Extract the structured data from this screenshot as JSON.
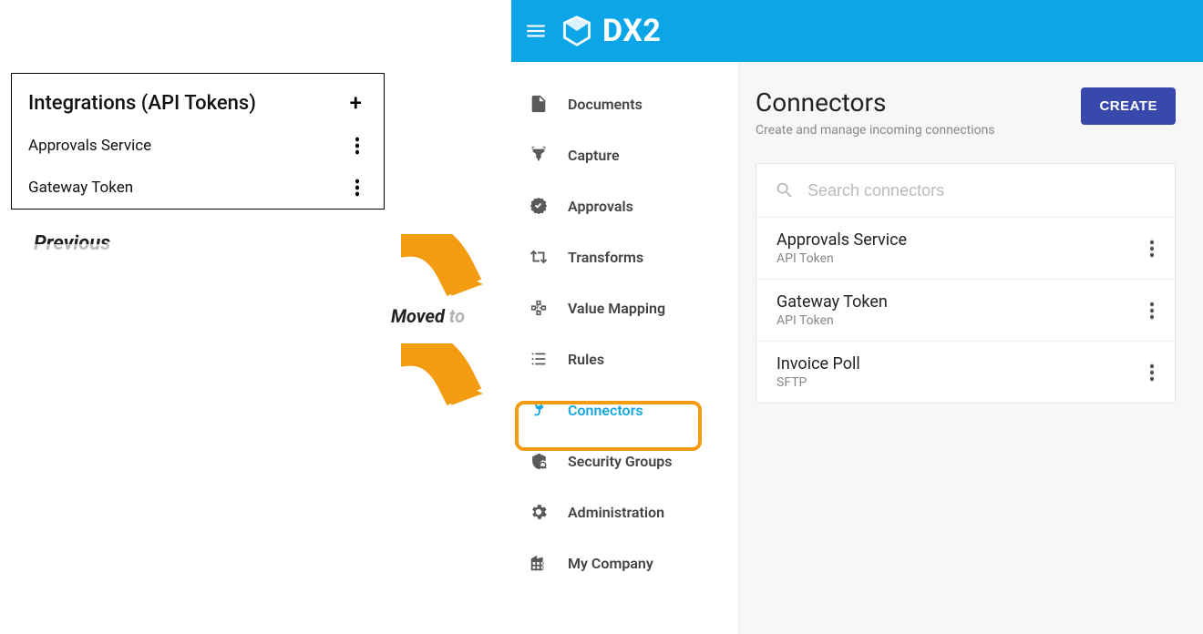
{
  "previous": {
    "title": "Integrations (API Tokens)",
    "rows": [
      "Approvals Service",
      "Gateway Token"
    ],
    "caption": "Previous"
  },
  "annotation": {
    "moved": "Moved",
    "to": " to"
  },
  "app": {
    "brand": "DX2",
    "nav": [
      {
        "icon": "doc",
        "label": "Documents"
      },
      {
        "icon": "capture",
        "label": "Capture"
      },
      {
        "icon": "approvals",
        "label": "Approvals"
      },
      {
        "icon": "transforms",
        "label": "Transforms"
      },
      {
        "icon": "mapping",
        "label": "Value Mapping"
      },
      {
        "icon": "rules",
        "label": "Rules"
      },
      {
        "icon": "connectors",
        "label": "Connectors",
        "active": true
      },
      {
        "icon": "security",
        "label": "Security Groups"
      },
      {
        "icon": "admin",
        "label": "Administration"
      },
      {
        "icon": "company",
        "label": "My Company"
      }
    ],
    "page": {
      "title": "Connectors",
      "subtitle": "Create and manage incoming connections",
      "create_label": "CREATE",
      "search_placeholder": "Search connectors",
      "connectors": [
        {
          "name": "Approvals Service",
          "type": "API Token"
        },
        {
          "name": "Gateway Token",
          "type": "API Token"
        },
        {
          "name": "Invoice Poll",
          "type": "SFTP"
        }
      ]
    }
  }
}
